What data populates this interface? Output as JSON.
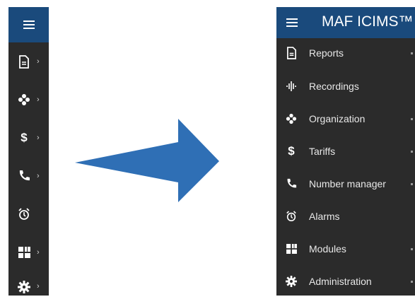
{
  "collapsed_sidebar": {
    "menu_icon": "hamburger-icon",
    "items": [
      {
        "icon": "document-icon",
        "has_chevron": true
      },
      {
        "icon": "organization-icon",
        "has_chevron": true
      },
      {
        "icon": "dollar-icon",
        "has_chevron": true
      },
      {
        "icon": "phone-icon",
        "has_chevron": true
      },
      {
        "icon": "alarm-clock-icon",
        "has_chevron": false
      },
      {
        "icon": "modules-icon",
        "has_chevron": true
      },
      {
        "icon": "gear-icon",
        "has_chevron": true
      }
    ],
    "chevron": "›",
    "dollar_glyph": "$"
  },
  "expanded_sidebar": {
    "title": "MAF ICIMS™",
    "items": [
      {
        "label": "Reports",
        "icon": "document-icon"
      },
      {
        "label": "Recordings",
        "icon": "audio-wave-icon"
      },
      {
        "label": "Organization",
        "icon": "organization-icon"
      },
      {
        "label": "Tariffs",
        "icon": "dollar-icon"
      },
      {
        "label": "Number manager",
        "icon": "phone-icon"
      },
      {
        "label": "Alarms",
        "icon": "alarm-clock-icon"
      },
      {
        "label": "Modules",
        "icon": "modules-icon"
      },
      {
        "label": "Administration",
        "icon": "gear-icon"
      }
    ]
  },
  "colors": {
    "sidebar_bg": "#2b2b2b",
    "header_bg": "#1a4a7c",
    "arrow": "#2f6fb5"
  }
}
